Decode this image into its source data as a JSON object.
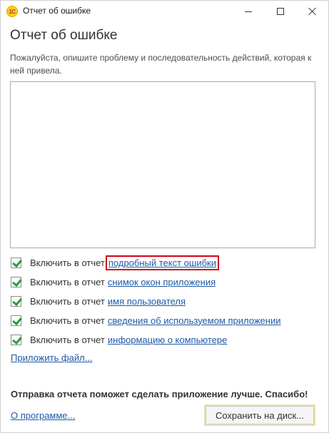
{
  "window": {
    "app_icon_text": "1С",
    "title": "Отчет об ошибке",
    "minimize_symbol": "—",
    "maximize_symbol": "☐",
    "close_symbol": "✕"
  },
  "form": {
    "heading": "Отчет об ошибке",
    "description": "Пожалуйста, опишите проблему и последовательность действий, которая к ней привела.",
    "description_text_value": ""
  },
  "include_options": [
    {
      "checked": true,
      "prefix": "Включить в отчет",
      "link": "подробный текст ошибки",
      "highlighted": true
    },
    {
      "checked": true,
      "prefix": "Включить в отчет",
      "link": "снимок окон приложения",
      "highlighted": false
    },
    {
      "checked": true,
      "prefix": "Включить в отчет",
      "link": "имя пользователя",
      "highlighted": false
    },
    {
      "checked": true,
      "prefix": "Включить в отчет",
      "link": "сведения об используемом приложении",
      "highlighted": false
    },
    {
      "checked": true,
      "prefix": "Включить в отчет",
      "link": "информацию о компьютере",
      "highlighted": false
    }
  ],
  "attach_file_link": "Приложить файл...",
  "thanks_text": "Отправка отчета поможет сделать приложение лучше. Спасибо!",
  "about_link": "О программе...",
  "save_button_label": "Сохранить на диск...",
  "colors": {
    "link": "#1f5aa6",
    "checkmark": "#2e9b3a",
    "highlight_box": "#d0021b",
    "app_icon": "#f7d21a"
  }
}
